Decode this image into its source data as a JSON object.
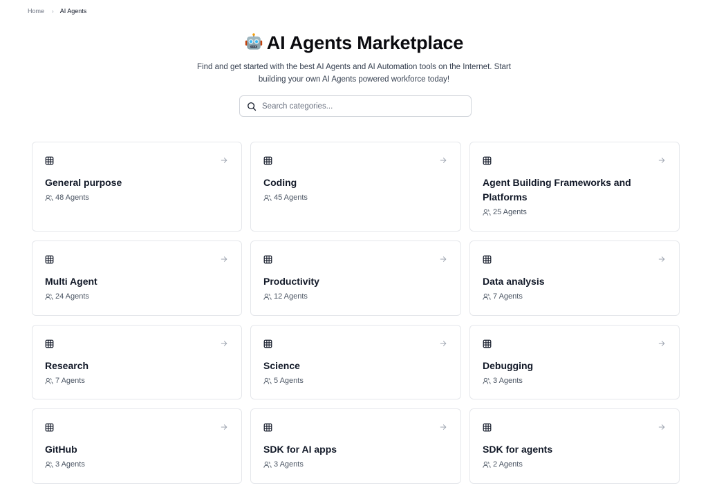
{
  "breadcrumb": {
    "items": [
      {
        "label": "Home"
      },
      {
        "label": "AI Agents"
      }
    ],
    "separator": "›"
  },
  "header": {
    "title_icon": "robot-emoji",
    "title": "AI Agents Marketplace",
    "subtitle": "Find and get started with the best AI Agents and AI Automation tools on the Internet. Start building your own AI Agents powered workforce today!"
  },
  "search": {
    "icon": "search-icon",
    "value": "",
    "placeholder": "Search categories..."
  },
  "categories": [
    {
      "title": "General purpose",
      "count": "48 Agents",
      "icon": "grid-icon"
    },
    {
      "title": "Coding",
      "count": "45 Agents",
      "icon": "grid-icon"
    },
    {
      "title": "Agent Building Frameworks and Platforms",
      "count": "25 Agents",
      "icon": "grid-icon"
    },
    {
      "title": "Multi Agent",
      "count": "24 Agents",
      "icon": "grid-icon"
    },
    {
      "title": "Productivity",
      "count": "12 Agents",
      "icon": "grid-icon"
    },
    {
      "title": "Data analysis",
      "count": "7 Agents",
      "icon": "grid-icon"
    },
    {
      "title": "Research",
      "count": "7 Agents",
      "icon": "grid-icon"
    },
    {
      "title": "Science",
      "count": "5 Agents",
      "icon": "grid-icon"
    },
    {
      "title": "Debugging",
      "count": "3 Agents",
      "icon": "grid-icon"
    },
    {
      "title": "GitHub",
      "count": "3 Agents",
      "icon": "grid-icon"
    },
    {
      "title": "SDK for AI apps",
      "count": "3 Agents",
      "icon": "grid-icon"
    },
    {
      "title": "SDK for agents",
      "count": "2 Agents",
      "icon": "grid-icon"
    }
  ],
  "colors": {
    "text_primary": "#111827",
    "text_secondary": "#4b5563",
    "border": "#e5e7eb",
    "arrow": "#9ca3af"
  }
}
